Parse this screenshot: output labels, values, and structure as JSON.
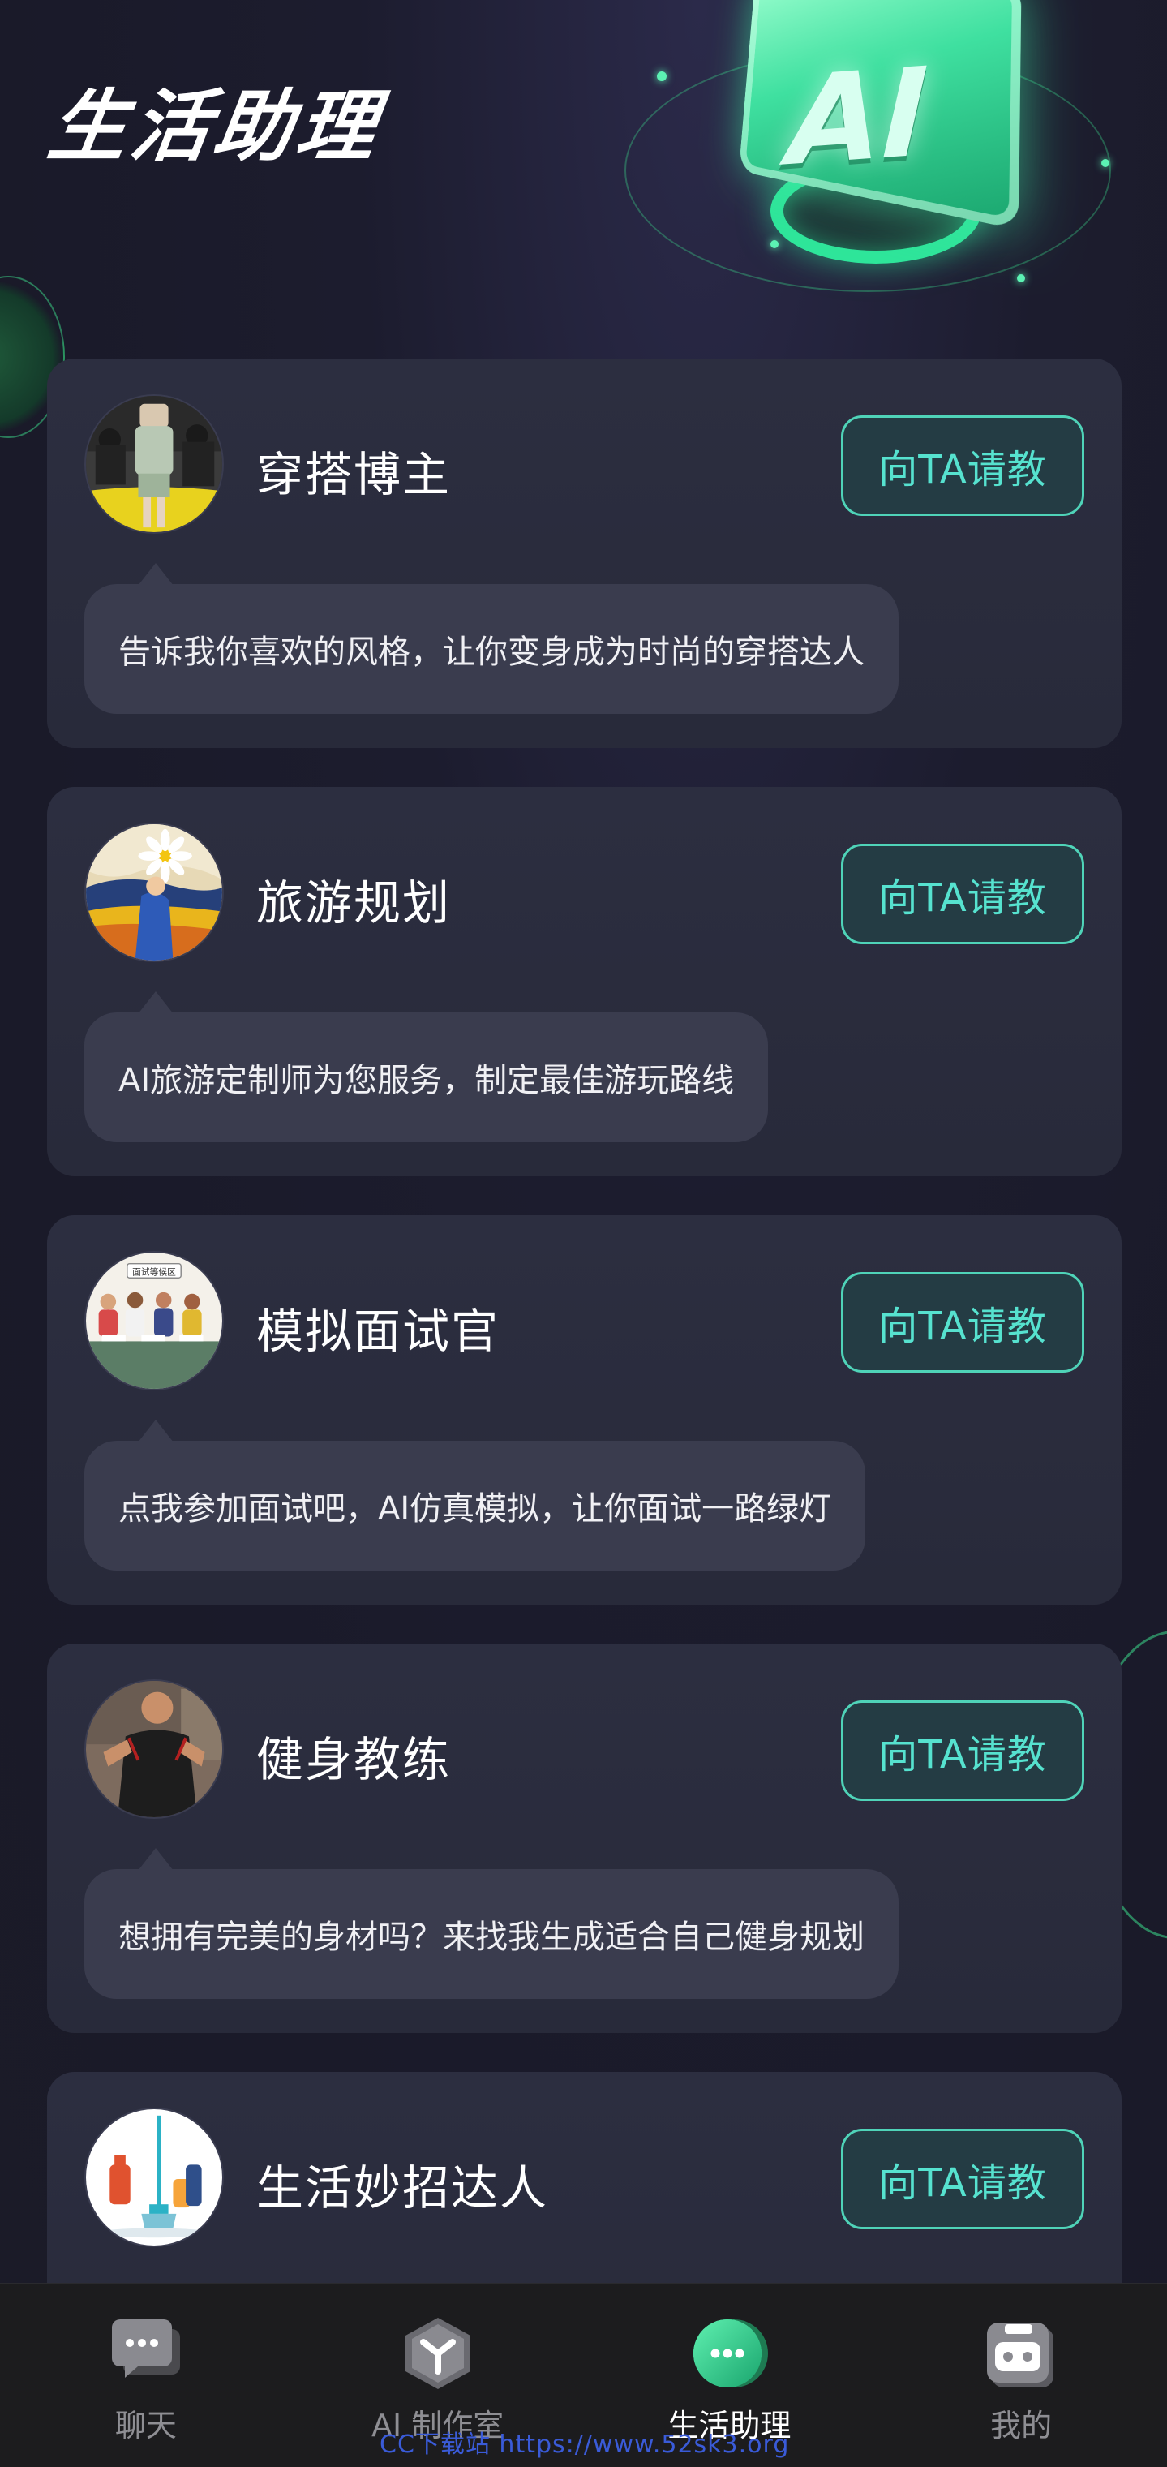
{
  "header": {
    "title": "生活助理",
    "emblem_text": "AI"
  },
  "colors": {
    "accent": "#56e2cf",
    "card_bg": "#2c2e40",
    "bubble_bg": "#3a3c4e",
    "active_tab": "#2ee59a"
  },
  "cards": [
    {
      "title": "穿搭博主",
      "button": "向TA请教",
      "description": "告诉我你喜欢的风格，让你变身成为时尚的穿搭达人",
      "avatar": "fashion-avatar"
    },
    {
      "title": "旅游规划",
      "button": "向TA请教",
      "description": "AI旅游定制师为您服务，制定最佳游玩路线",
      "avatar": "travel-avatar"
    },
    {
      "title": "模拟面试官",
      "button": "向TA请教",
      "description": "点我参加面试吧，AI仿真模拟，让你面试一路绿灯",
      "avatar": "interview-avatar",
      "avatar_text": "面试等候区"
    },
    {
      "title": "健身教练",
      "button": "向TA请教",
      "description": "想拥有完美的身材吗？来找我生成适合自己健身规划",
      "avatar": "fitness-avatar"
    },
    {
      "title": "生活妙招达人",
      "button": "向TA请教",
      "description": "",
      "avatar": "life-tips-avatar"
    }
  ],
  "tabbar": {
    "tabs": [
      {
        "label": "聊天",
        "icon": "chat-icon",
        "active": false
      },
      {
        "label": "AI 制作室",
        "icon": "studio-icon",
        "active": false
      },
      {
        "label": "生活助理",
        "icon": "assistant-icon",
        "active": true
      },
      {
        "label": "我的",
        "icon": "profile-robot-icon",
        "active": false
      }
    ]
  },
  "watermark": "CC下载站 https://www.52sk3.org"
}
